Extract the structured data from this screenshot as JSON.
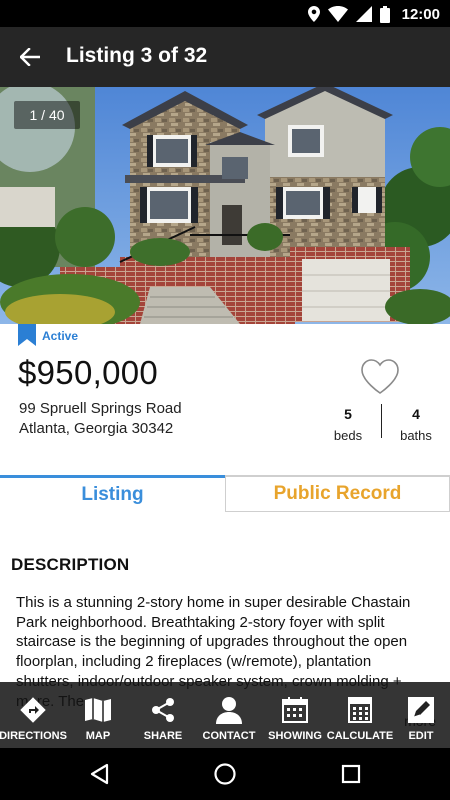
{
  "status_bar": {
    "time": "12:00",
    "icons": [
      "location-icon",
      "wifi-icon",
      "signal-icon",
      "battery-icon"
    ]
  },
  "app_bar": {
    "title": "Listing 3 of 32",
    "back_icon": "arrow-left-icon"
  },
  "photo": {
    "counter": "1 / 40"
  },
  "listing": {
    "status": "Active",
    "price": "$950,000",
    "address_line1": "99 Spruell Springs Road",
    "address_line2": "Atlanta, Georgia 30342",
    "favorite_icon": "heart-outline-icon",
    "beds_value": "5",
    "beds_label": "beds",
    "baths_value": "4",
    "baths_label": "baths"
  },
  "tabs": [
    {
      "label": "Listing",
      "selected": true
    },
    {
      "label": "Public Record",
      "selected": false
    }
  ],
  "description": {
    "heading": "DESCRIPTION",
    "body": "This is a stunning 2-story home in super desirable Chastain Park neighborhood. Breathtaking 2-story foyer with split staircase is the beginning of upgrades throughout the open floorplan, including 2 fireplaces (w/remote), plantation shutters, indoor/outdoor speaker system, crown molding + more. The",
    "more_label": "more"
  },
  "toolbar": {
    "items": [
      {
        "label": "DIRECTIONS",
        "icon": "directions-icon"
      },
      {
        "label": "MAP",
        "icon": "map-icon"
      },
      {
        "label": "SHARE",
        "icon": "share-icon"
      },
      {
        "label": "CONTACT",
        "icon": "contact-icon"
      },
      {
        "label": "SHOWING",
        "icon": "calendar-icon"
      },
      {
        "label": "CALCULATE",
        "icon": "calculator-icon"
      },
      {
        "label": "EDIT",
        "icon": "edit-icon"
      }
    ]
  },
  "colors": {
    "accent_blue": "#3a8edb",
    "public_record_orange": "#e8a42c",
    "app_bar": "#262626"
  }
}
